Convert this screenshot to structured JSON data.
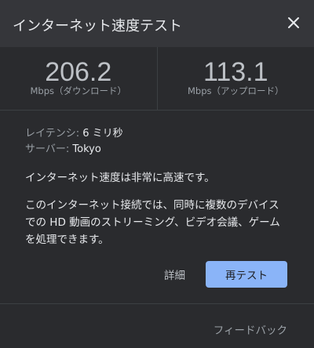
{
  "header": {
    "title": "インターネット速度テスト",
    "close_icon": "close-icon"
  },
  "download": {
    "value": "206.2",
    "unit": "Mbps（ダウンロード）"
  },
  "upload": {
    "value": "113.1",
    "unit": "Mbps（アップロード）"
  },
  "latency": {
    "label": "レイテンシ: ",
    "value": "6 ミリ秒"
  },
  "server": {
    "label": "サーバー: ",
    "value": "Tokyo"
  },
  "summary": "インターネット速度は非常に高速です。",
  "description": [
    "このインターネット接続では、同時に複数のデバイス",
    "での HD 動画のストリーミング、ビデオ会議、ゲーム",
    "を処理できます。"
  ],
  "actions": {
    "details_label": "詳細",
    "retest_label": "再テスト"
  },
  "footer": {
    "feedback_label": "フィードバック"
  },
  "colors": {
    "accent": "#8ab4f8",
    "background": "#2a2b2e",
    "header_background": "#35363a"
  }
}
